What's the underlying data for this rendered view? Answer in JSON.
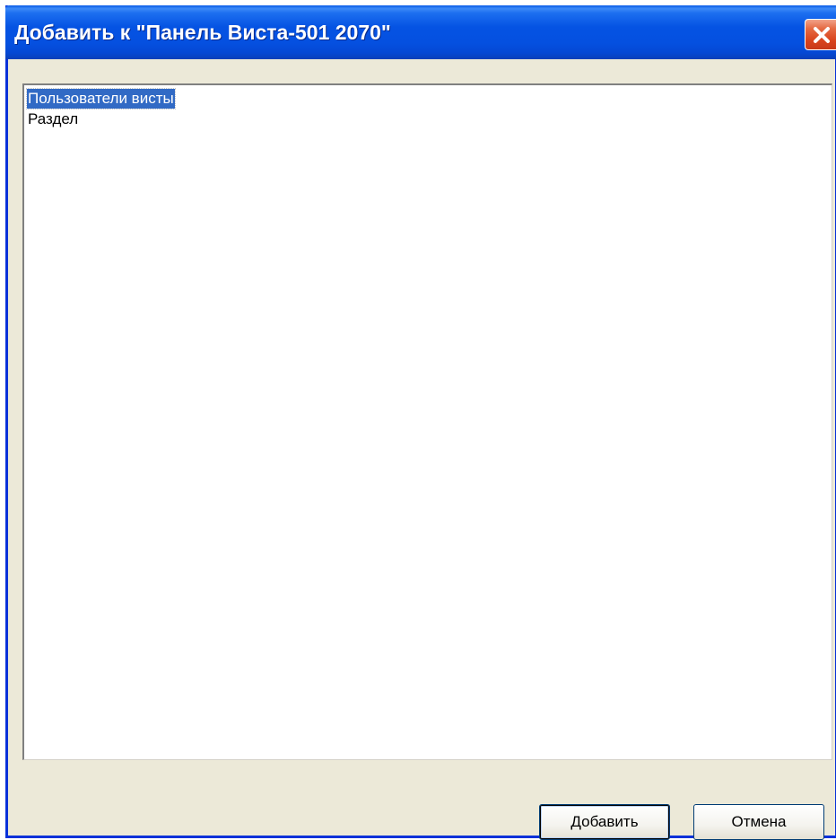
{
  "window": {
    "title": "Добавить к \"Панель Виста-501 2070\""
  },
  "titlebar": {
    "close_icon": "close-icon"
  },
  "list": {
    "items": [
      {
        "label": "Пользователи висты",
        "selected": true
      },
      {
        "label": "Раздел",
        "selected": false
      }
    ]
  },
  "buttons": {
    "add_label": "Добавить",
    "cancel_label": "Отмена"
  },
  "colors": {
    "title_bar": "#0553e3",
    "window_face": "#ece9d8",
    "selection": "#316ac5",
    "close_button": "#d9441d"
  }
}
